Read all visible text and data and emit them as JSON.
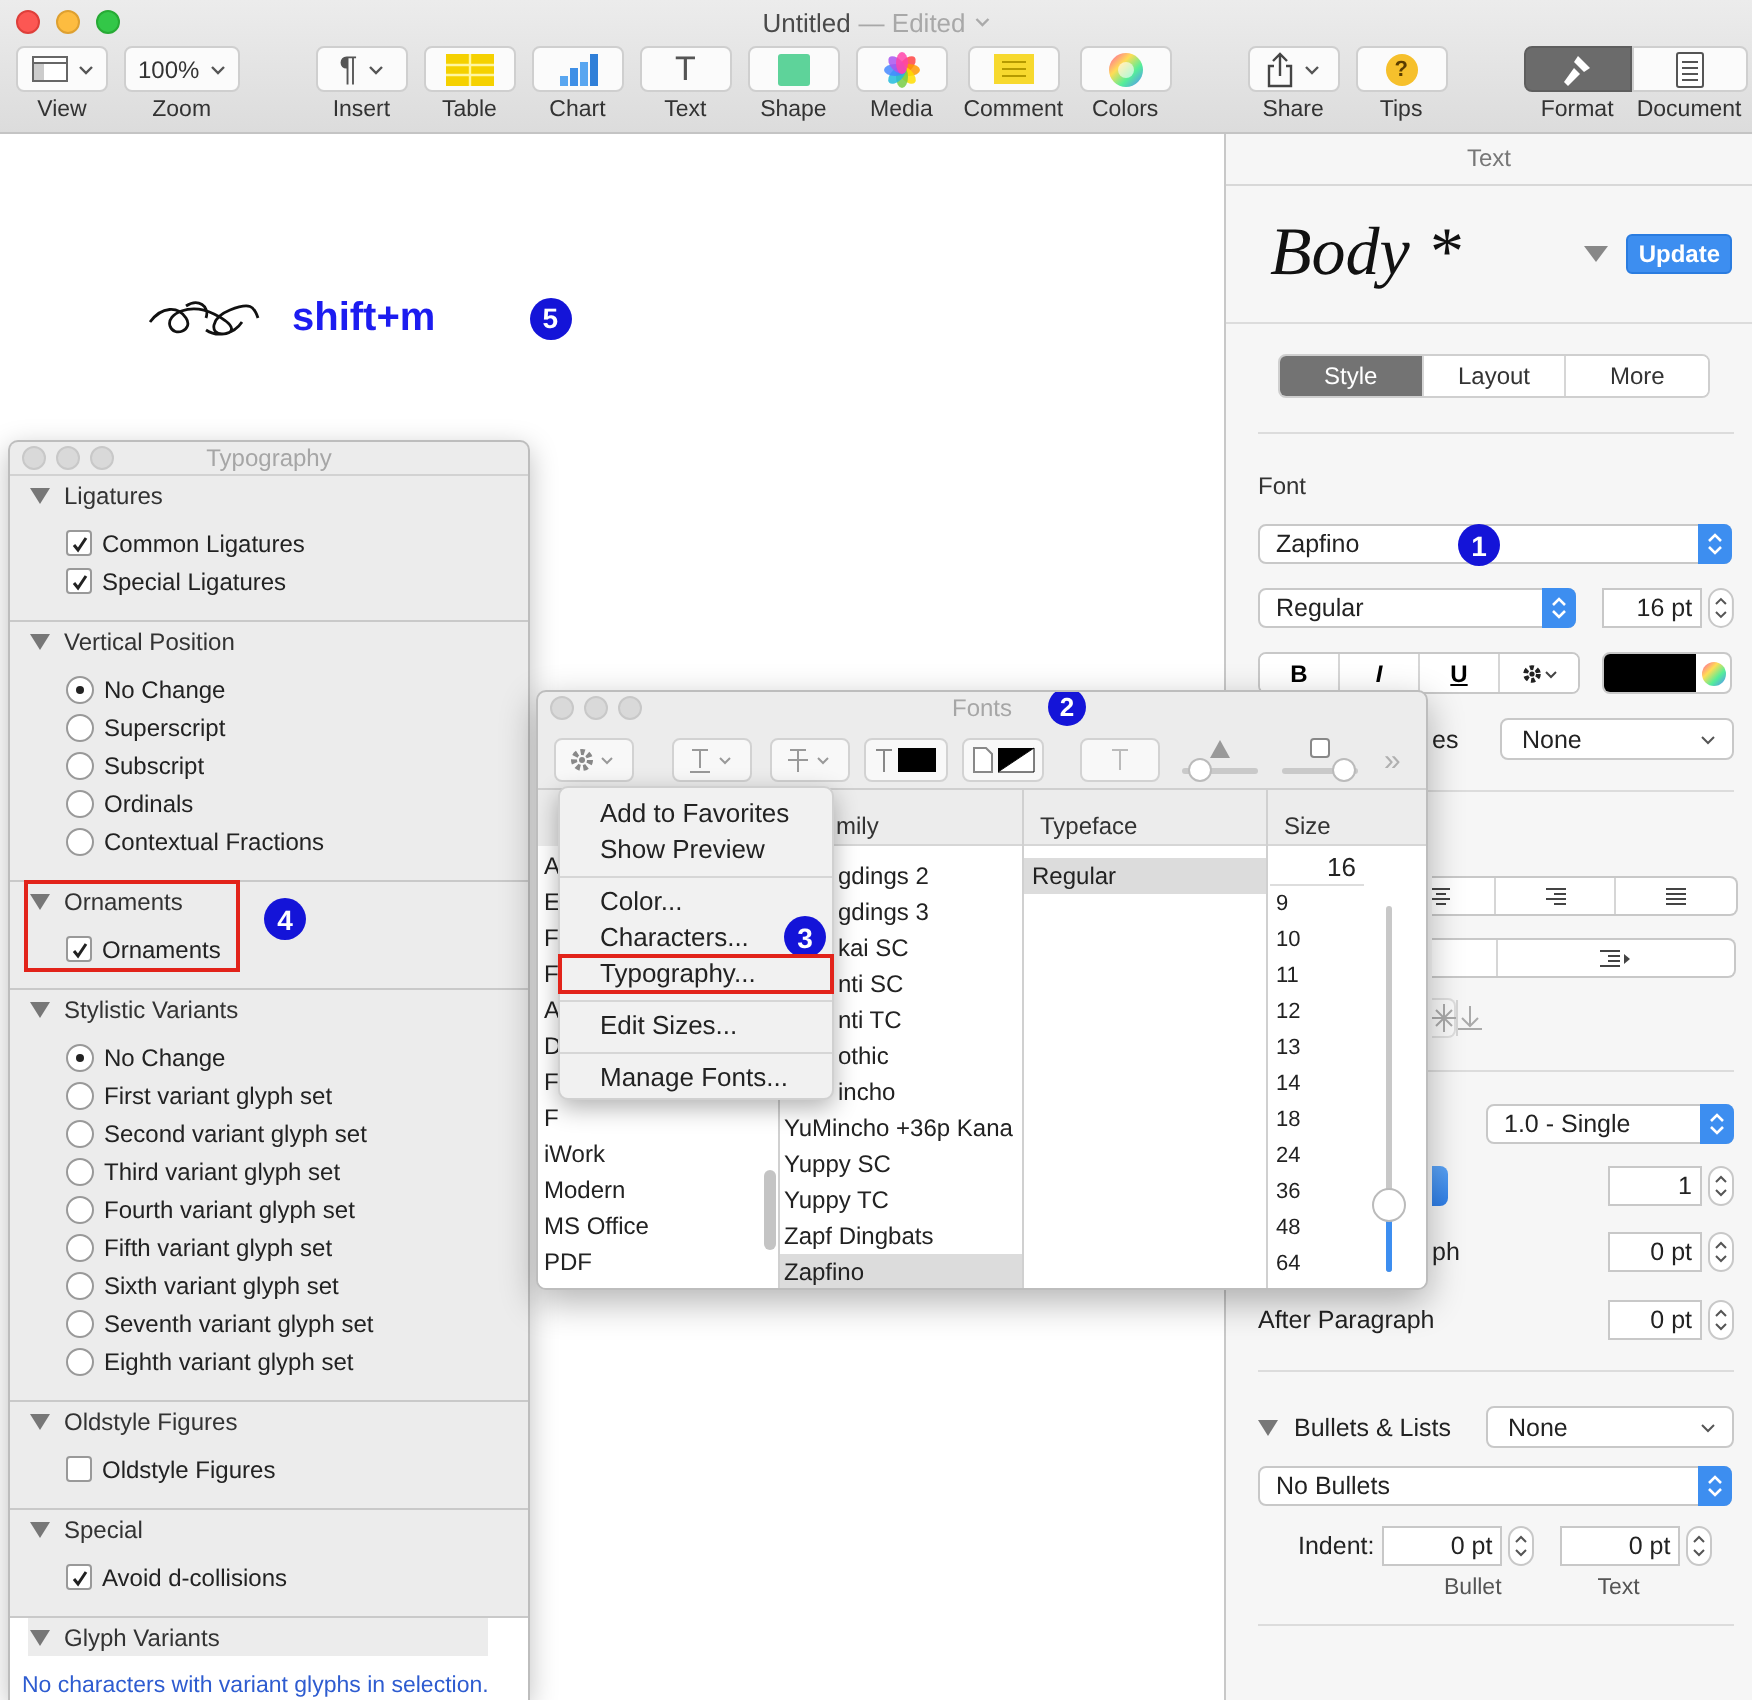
{
  "window": {
    "title": "Untitled",
    "status": "— Edited"
  },
  "toolbar": {
    "groups": [
      {
        "items": [
          {
            "label": "View",
            "kind": "view",
            "menu": true
          },
          {
            "label": "Zoom",
            "kind": "zoom",
            "value": "100%",
            "menu": true
          }
        ]
      },
      {
        "items": [
          {
            "label": "Insert",
            "kind": "insert",
            "glyph": "¶",
            "menu": true
          },
          {
            "label": "Table",
            "kind": "table"
          },
          {
            "label": "Chart",
            "kind": "chart"
          },
          {
            "label": "Text",
            "kind": "text",
            "glyph": "T"
          },
          {
            "label": "Shape",
            "kind": "shape"
          },
          {
            "label": "Media",
            "kind": "media"
          },
          {
            "label": "Comment",
            "kind": "comment"
          },
          {
            "label": "Colors",
            "kind": "colors"
          }
        ]
      },
      {
        "items": [
          {
            "label": "Share",
            "kind": "share",
            "menu": true
          },
          {
            "label": "Tips",
            "kind": "tips",
            "glyph": "?"
          }
        ]
      },
      {
        "items": [
          {
            "label": "Format",
            "kind": "format",
            "selected": true
          },
          {
            "label": "Document",
            "kind": "document",
            "selected": false
          }
        ]
      }
    ]
  },
  "canvas": {
    "sample_text": "shift+m",
    "callout": "5"
  },
  "inspector": {
    "header": "Text",
    "style_name": "Body *",
    "update": "Update",
    "tabs": [
      {
        "label": "Style",
        "selected": true
      },
      {
        "label": "Layout",
        "selected": false
      },
      {
        "label": "More",
        "selected": false
      }
    ],
    "font_heading": "Font",
    "font_family": "Zapfino",
    "font_callout": "1",
    "font_style": "Regular",
    "font_size": "16 pt",
    "format_buttons": [
      "B",
      "I",
      "U"
    ],
    "ligatures_label": "es",
    "ligatures_value": "None",
    "spacing_value": "1.0 - Single",
    "spacing_count": "1",
    "before_label": "ph",
    "before_value": "0 pt",
    "after_label": "After Paragraph",
    "after_value": "0 pt",
    "bullets_heading": "Bullets & Lists",
    "bullets_value": "None",
    "bullet_style": "No Bullets",
    "indent_label": "Indent:",
    "indents": [
      {
        "value": "0 pt",
        "caption": "Bullet"
      },
      {
        "value": "0 pt",
        "caption": "Text"
      }
    ]
  },
  "typography": {
    "title": "Typography",
    "sections": [
      {
        "title": "Ligatures",
        "highlighted": false,
        "items": [
          {
            "kind": "checkbox",
            "label": "Common Ligatures",
            "checked": true
          },
          {
            "kind": "checkbox",
            "label": "Special Ligatures",
            "checked": true
          }
        ]
      },
      {
        "title": "Vertical Position",
        "highlighted": false,
        "items": [
          {
            "kind": "radio",
            "label": "No Change",
            "selected": true
          },
          {
            "kind": "radio",
            "label": "Superscript",
            "selected": false
          },
          {
            "kind": "radio",
            "label": "Subscript",
            "selected": false
          },
          {
            "kind": "radio",
            "label": "Ordinals",
            "selected": false
          },
          {
            "kind": "radio",
            "label": "Contextual Fractions",
            "selected": false
          }
        ]
      },
      {
        "title": "Ornaments",
        "highlighted": true,
        "callout": "4",
        "items": [
          {
            "kind": "checkbox",
            "label": "Ornaments",
            "checked": true
          }
        ]
      },
      {
        "title": "Stylistic Variants",
        "highlighted": false,
        "items": [
          {
            "kind": "radio",
            "label": "No Change",
            "selected": true
          },
          {
            "kind": "radio",
            "label": "First variant glyph set",
            "selected": false
          },
          {
            "kind": "radio",
            "label": "Second variant glyph set",
            "selected": false
          },
          {
            "kind": "radio",
            "label": "Third variant glyph set",
            "selected": false
          },
          {
            "kind": "radio",
            "label": "Fourth variant glyph set",
            "selected": false
          },
          {
            "kind": "radio",
            "label": "Fifth variant glyph set",
            "selected": false
          },
          {
            "kind": "radio",
            "label": "Sixth variant glyph set",
            "selected": false
          },
          {
            "kind": "radio",
            "label": "Seventh variant glyph set",
            "selected": false
          },
          {
            "kind": "radio",
            "label": "Eighth variant glyph set",
            "selected": false
          }
        ]
      },
      {
        "title": "Oldstyle Figures",
        "highlighted": false,
        "items": [
          {
            "kind": "checkbox",
            "label": "Oldstyle Figures",
            "checked": false
          }
        ]
      },
      {
        "title": "Special",
        "highlighted": false,
        "items": [
          {
            "kind": "checkbox",
            "label": "Avoid d-collisions",
            "checked": true
          }
        ]
      },
      {
        "title": "Glyph Variants",
        "highlighted": false,
        "items": [
          {
            "kind": "note",
            "text": "No characters with variant glyphs in selection."
          }
        ]
      }
    ]
  },
  "fonts": {
    "title": "Fonts",
    "callout": "2",
    "sliders": [
      {
        "level": 0.1
      },
      {
        "level": 0.95
      }
    ],
    "overflow": "»",
    "headers": [
      "mily",
      "Typeface",
      "Size"
    ],
    "collections": [
      "A",
      "E",
      "F",
      "F",
      "A",
      "D",
      "F",
      "F",
      "iWork",
      "Modern",
      "MS Office",
      "PDF"
    ],
    "families": [
      {
        "name": "gdings 2",
        "selected": false
      },
      {
        "name": "gdings 3",
        "selected": false
      },
      {
        "name": "kai SC",
        "selected": false
      },
      {
        "name": "nti SC",
        "selected": false
      },
      {
        "name": "nti TC",
        "selected": false
      },
      {
        "name": "othic",
        "selected": false
      },
      {
        "name": "incho",
        "selected": false
      },
      {
        "name": "YuMincho +36p Kana",
        "selected": false
      },
      {
        "name": "Yuppy SC",
        "selected": false
      },
      {
        "name": "Yuppy TC",
        "selected": false
      },
      {
        "name": "Zapf Dingbats",
        "selected": false
      },
      {
        "name": "Zapfino",
        "selected": true
      }
    ],
    "typefaces": [
      {
        "name": "Regular",
        "selected": true
      }
    ],
    "size": {
      "value": "16",
      "options": [
        "9",
        "10",
        "11",
        "12",
        "13",
        "14",
        "18",
        "24",
        "36",
        "48",
        "64"
      ],
      "level": 0.15
    },
    "menu": [
      {
        "kind": "item",
        "label": "Add to Favorites",
        "highlighted": false
      },
      {
        "kind": "item",
        "label": "Show Preview",
        "highlighted": false
      },
      {
        "kind": "separator"
      },
      {
        "kind": "item",
        "label": "Color...",
        "highlighted": false
      },
      {
        "kind": "item",
        "label": "Characters...",
        "highlighted": false,
        "callout": "3"
      },
      {
        "kind": "item",
        "label": "Typography...",
        "highlighted": true
      },
      {
        "kind": "separator"
      },
      {
        "kind": "item",
        "label": "Edit Sizes...",
        "highlighted": false
      },
      {
        "kind": "separator"
      },
      {
        "kind": "item",
        "label": "Manage Fonts...",
        "highlighted": false
      }
    ]
  }
}
